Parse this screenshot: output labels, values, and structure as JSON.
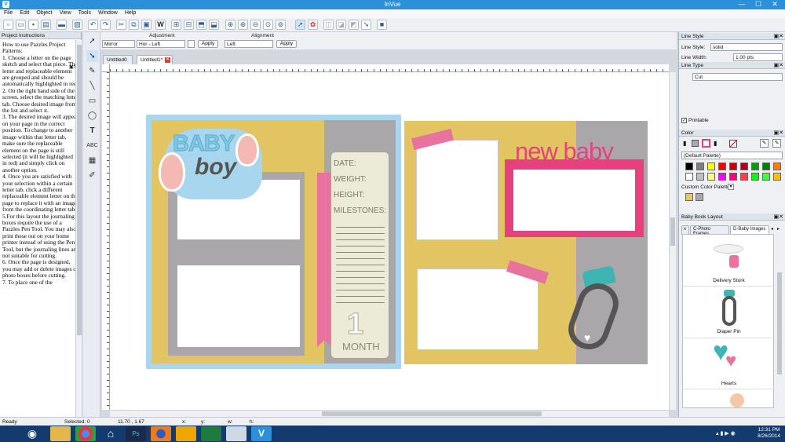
{
  "window": {
    "title": "InVue",
    "minimize": "—",
    "maximize": "☐",
    "close": "✕"
  },
  "menu": [
    "File",
    "Edit",
    "Object",
    "View",
    "Tools",
    "Window",
    "Help"
  ],
  "left_panel": {
    "title": "Project Instructions",
    "text": "How to use Pazzles Project Patterns:\n1. Choose a letter on the page sketch and select that piece. The letter and replaceable element are grouped and should be automatically highlighted in red.\n2. On the right hand side of the screen, select the matching letter tab. Choose desired image from the list and select it.\n3. The desired image will appear on your page in the correct position. To change to another image within that letter tab, make sure the replaceable element on the page is still selected (it will be highlighted in red) and simply click on another option.\n4. Once you are satisfied with your selection within a certain letter tab, click a different replaceable element letter on the page to replace it with an image from the coordinating letter tab.\n5.For this layout the journaling boxes require the use of a Pazzles Pen Tool. You may also print these out on your home printer instead of using the Pen Tool, but the journaling lines are not suitable for cutting.\n6. Once the page is designed, you may add or delete images or photo boxes before cutting.\n7. To place one of the"
  },
  "adjustment": {
    "label": "Adjustment",
    "mirror": "Mirror",
    "hor": "Hor - Left",
    "apply": "Apply"
  },
  "alignment": {
    "label": "Alignment",
    "value": "Left",
    "apply": "Apply"
  },
  "tabs": [
    "Untitled0",
    "Untitled1*"
  ],
  "page": {
    "baby": "BABY",
    "boy": "boy",
    "journal": [
      "DATE:",
      "WEIGHT:",
      "HEIGHT:",
      "MILESTONES:"
    ],
    "month_num": "1",
    "month": "MONTH",
    "new_baby": "new baby"
  },
  "status": {
    "ready": "Ready",
    "selected": "Selected: 0",
    "coords": "11.70 , 1.67",
    "x": "x:",
    "y": "y:",
    "w": "w:",
    "h": "h:"
  },
  "right_panel": {
    "line_style_title": "Line Style",
    "line_style_label": "Line Style:",
    "line_style_value": "solid",
    "line_width_label": "Line Width:",
    "line_width_value": "1.00 pts",
    "line_type_title": "Line Type",
    "line_type_value": "Cut",
    "printable": "Printable",
    "color_title": "Color",
    "palette": "(Default Palette)",
    "custom_palette": "Custom Color Palette",
    "book_title": "Baby Book Layout",
    "book_tabs": [
      "x",
      "C-Photo Frames",
      "D-Baby Images"
    ],
    "thumbs": [
      "Delivery Stork",
      "Diaper Pin",
      "Hearts"
    ]
  },
  "palette_colors": [
    "#000000",
    "#808080",
    "#ffff00",
    "#ff0000",
    "#d00000",
    "#b00020",
    "#00a000",
    "#008000",
    "#ff8000",
    "#ffffff",
    "#c0c0c0",
    "#ffff80",
    "#ff00ff",
    "#ff0080",
    "#ff4040",
    "#00ff00",
    "#40ff40",
    "#ffc000"
  ],
  "custom_colors": [
    "#e8c860",
    "#a8a8a8"
  ],
  "colors": {
    "page_yellow": "#e3c463",
    "page_gray": "#aaa7ab",
    "pink": "#e8739e",
    "blue": "#a7d6ee",
    "magenta": "#e8407f",
    "teal": "#3fb5b3"
  },
  "clock": {
    "time": "12:31 PM",
    "date": "8/26/2014"
  }
}
